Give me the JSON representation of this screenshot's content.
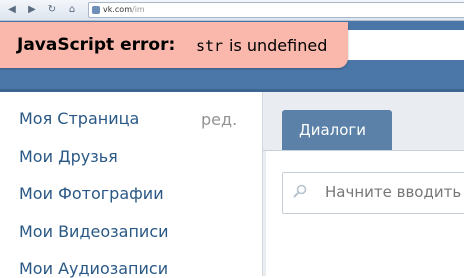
{
  "browser": {
    "back_glyph": "◀",
    "forward_glyph": "▶",
    "reload_glyph": "↻",
    "home_glyph": "⌂",
    "url_host": "vk.com",
    "url_path": "/im"
  },
  "error": {
    "label": "JavaScript error:",
    "code": "str",
    "message": "is undefined",
    "background": "#f9b8ab"
  },
  "colors": {
    "header": "#4a76a8",
    "tab": "#5b81a8",
    "link": "#2a5885"
  },
  "left_menu": {
    "items": [
      {
        "label": "Моя Страница"
      },
      {
        "label": "Мои Друзья"
      },
      {
        "label": "Мои Фотографии"
      },
      {
        "label": "Мои Видеозаписи"
      },
      {
        "label": "Мои Аудиозаписи"
      }
    ],
    "edit_label": "ред."
  },
  "messages": {
    "tab_label": "Диалоги",
    "search_placeholder": "Начните вводить"
  }
}
